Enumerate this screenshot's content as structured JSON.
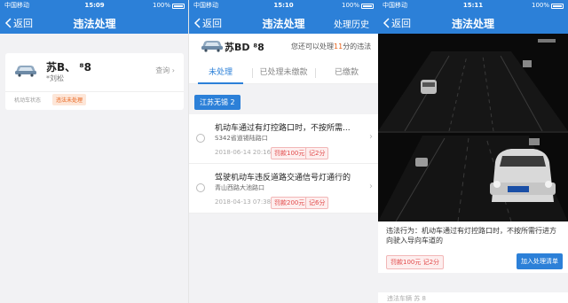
{
  "screen1": {
    "status": {
      "carrier": "中国移动",
      "time": "15:09",
      "battery": "100%"
    },
    "nav": {
      "back": "返回",
      "title": "违法处理"
    },
    "card": {
      "plate": "苏B、  ⁸8",
      "owner": "*刘松",
      "query": "查询",
      "status_label": "机动车状态",
      "status_value": "违法未处理"
    }
  },
  "screen2": {
    "status": {
      "carrier": "中国移动",
      "time": "15:10",
      "battery": "100%"
    },
    "nav": {
      "back": "返回",
      "title": "违法处理",
      "right": "处理历史"
    },
    "header": {
      "plate": "苏BD  ⁸8",
      "remain_prefix": "您还可以处理",
      "remain_count": "11",
      "remain_suffix": "分的违法"
    },
    "tabs": [
      "未处理",
      "已处理未缴款",
      "已缴款"
    ],
    "region": "江苏无锡 2",
    "violations": [
      {
        "title": "机动车通过有灯控路口时，不按所需...",
        "location": "S342省道锡陆路口",
        "time": "2018-06-14 20:16",
        "fine": "罚款100元",
        "points": "记2分"
      },
      {
        "title": "驾驶机动车违反道路交通信号灯通行的",
        "location": "青山西路大池路口",
        "time": "2018-04-13 07:38",
        "fine": "罚款200元",
        "points": "记6分"
      }
    ]
  },
  "screen3": {
    "status": {
      "carrier": "中国移动",
      "time": "15:11",
      "battery": "100%"
    },
    "nav": {
      "back": "返回",
      "title": "违法处理"
    },
    "desc": "违法行为：机动车通过有灯控路口时，不按所需行进方向驶入导向车道的",
    "fine": "罚款100元  记2分",
    "add_button": "加入处理清单",
    "peek_text": "违法车辆    苏      8"
  }
}
